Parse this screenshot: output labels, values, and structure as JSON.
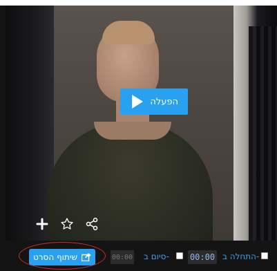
{
  "player": {
    "play_label": "הפעלה"
  },
  "controls": {
    "add_icon": "plus-icon",
    "favorite_icon": "star-icon",
    "share_icon": "share-nodes-icon"
  },
  "bottom_bar": {
    "share_movie_label": "שיתוף הסרט",
    "start_label": "התחלה ב-",
    "start_value": "00:00",
    "end_label": "סיום ב-",
    "end_placeholder": "00:00"
  },
  "colors": {
    "accent": "#2aa0f0",
    "annotation": "#d42a2a"
  }
}
